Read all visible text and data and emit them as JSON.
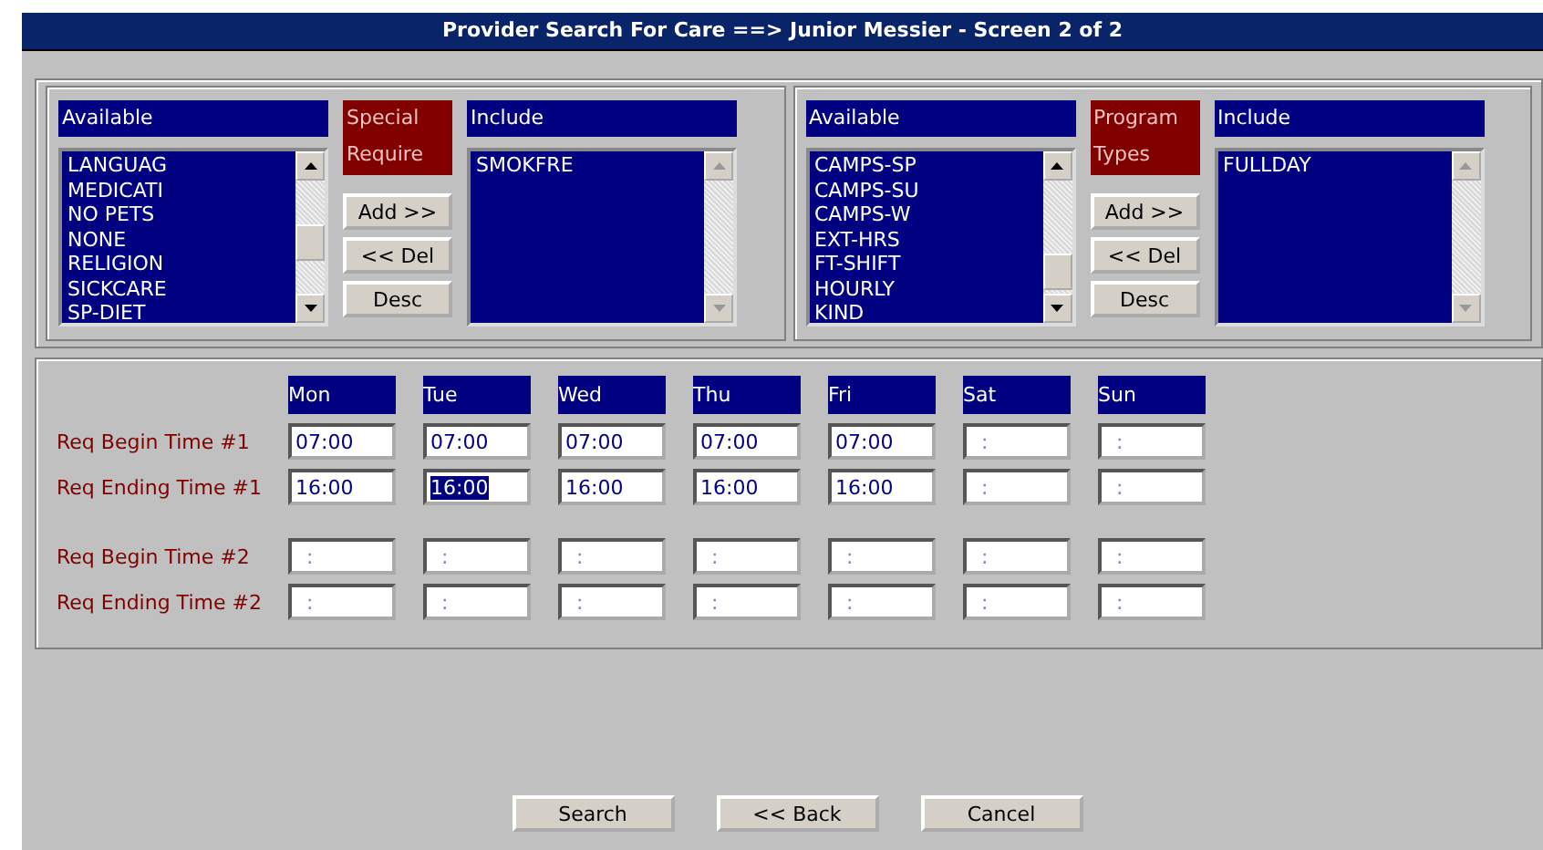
{
  "window": {
    "title": "Provider Search For Care ==> Junior Messier - Screen 2 of 2"
  },
  "groups": [
    {
      "available_header": "Available",
      "category": "Special Require",
      "include_header": "Include",
      "available": [
        "LANGUAG",
        "MEDICATI",
        "NO PETS",
        "NONE",
        "RELIGION",
        "SICKCARE",
        "SP-DIET"
      ],
      "include": [
        "SMOKFRE"
      ],
      "buttons": [
        "Add >>",
        "<< Del",
        "Desc"
      ]
    },
    {
      "available_header": "Available",
      "category": "Program Types",
      "include_header": "Include",
      "available": [
        "CAMPS-SP",
        "CAMPS-SU",
        "CAMPS-W",
        "EXT-HRS",
        "FT-SHIFT",
        "HOURLY",
        "KIND"
      ],
      "include": [
        "FULLDAY"
      ],
      "buttons": [
        "Add >>",
        "<< Del",
        "Desc"
      ]
    }
  ],
  "schedule": {
    "days": [
      "Mon",
      "Tue",
      "Wed",
      "Thu",
      "Fri",
      "Sat",
      "Sun"
    ],
    "rows": [
      {
        "label": "Req Begin Time #1",
        "times": [
          {
            "value": "07:00",
            "selected": false
          },
          {
            "value": "07:00",
            "selected": false
          },
          {
            "value": "07:00",
            "selected": false
          },
          {
            "value": "07:00",
            "selected": false
          },
          {
            "value": "07:00",
            "selected": false
          },
          {
            "value": ":",
            "selected": false
          },
          {
            "value": ":",
            "selected": false
          }
        ]
      },
      {
        "label": "Req Ending Time #1",
        "times": [
          {
            "value": "16:00",
            "selected": false
          },
          {
            "value": "16:00",
            "selected": true
          },
          {
            "value": "16:00",
            "selected": false
          },
          {
            "value": "16:00",
            "selected": false
          },
          {
            "value": "16:00",
            "selected": false
          },
          {
            "value": ":",
            "selected": false
          },
          {
            "value": ":",
            "selected": false
          }
        ]
      },
      {
        "label": "Req Begin Time #2",
        "times": [
          {
            "value": ":",
            "selected": false
          },
          {
            "value": ":",
            "selected": false
          },
          {
            "value": ":",
            "selected": false
          },
          {
            "value": ":",
            "selected": false
          },
          {
            "value": ":",
            "selected": false
          },
          {
            "value": ":",
            "selected": false
          },
          {
            "value": ":",
            "selected": false
          }
        ]
      },
      {
        "label": "Req Ending Time #2",
        "times": [
          {
            "value": ":",
            "selected": false
          },
          {
            "value": ":",
            "selected": false
          },
          {
            "value": ":",
            "selected": false
          },
          {
            "value": ":",
            "selected": false
          },
          {
            "value": ":",
            "selected": false
          },
          {
            "value": ":",
            "selected": false
          },
          {
            "value": ":",
            "selected": false
          }
        ]
      }
    ]
  },
  "buttons": [
    "Search",
    "<< Back",
    "Cancel"
  ]
}
